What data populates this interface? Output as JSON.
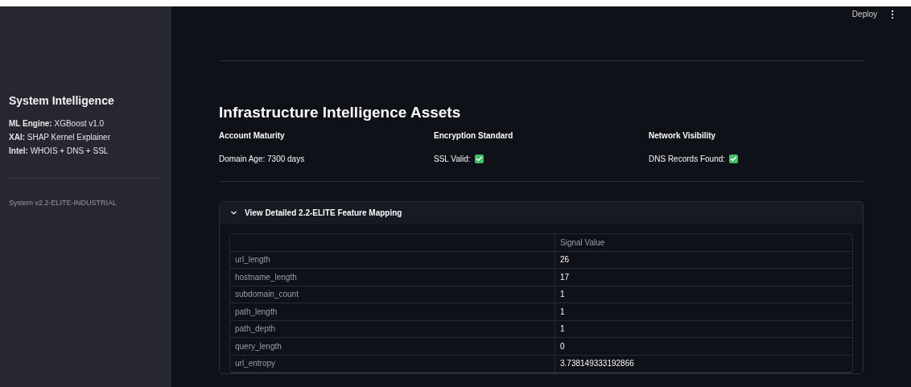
{
  "toolbar": {
    "deploy": "Deploy"
  },
  "sidebar": {
    "title": "System Intelligence",
    "lines": [
      "**ML Engine:** XGBoost v1.0",
      "**XAI:** SHAP Kernel Explainer",
      "**Intel:** WHOIS + DNS + SSL"
    ],
    "version": "System v2.2-ELITE-INDUSTRIAL"
  },
  "section": {
    "title": "Infrastructure Intelligence Assets",
    "metrics": [
      {
        "label": "Account Maturity",
        "value": "Domain Age: 7300 days"
      },
      {
        "label": "Encryption Standard",
        "value": "SSL Valid:",
        "checked": true
      },
      {
        "label": "Network Visibility",
        "value": "DNS Records Found:",
        "checked": true
      }
    ]
  },
  "expander": {
    "title": "View Detailed 2.2-ELITE Feature Mapping",
    "expanded": true,
    "table": {
      "columns": [
        "",
        "Signal Value"
      ],
      "rows": [
        [
          "url_length",
          "26"
        ],
        [
          "hostname_length",
          "17"
        ],
        [
          "subdomain_count",
          "1"
        ],
        [
          "path_length",
          "1"
        ],
        [
          "path_depth",
          "1"
        ],
        [
          "query_length",
          "0"
        ],
        [
          "url_entropy",
          "3.738149333192866"
        ]
      ]
    }
  }
}
